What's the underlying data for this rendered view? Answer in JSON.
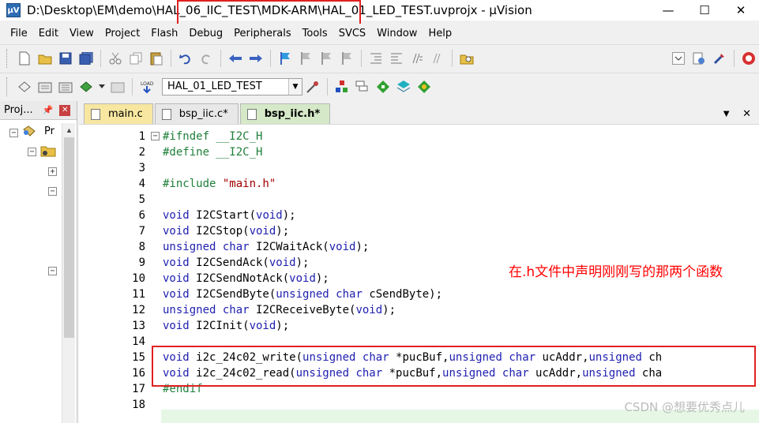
{
  "window": {
    "title": "D:\\Desktop\\EM\\demo\\HAL_06_IIC_TEST\\MDK-ARM\\HAL_01_LED_TEST.uvprojx - µVision",
    "minimize": "—",
    "maximize": "☐",
    "close": "✕"
  },
  "menu": {
    "items": [
      "File",
      "Edit",
      "View",
      "Project",
      "Flash",
      "Debug",
      "Peripherals",
      "Tools",
      "SVCS",
      "Window",
      "Help"
    ]
  },
  "toolbar2": {
    "target": "HAL_01_LED_TEST"
  },
  "project_panel": {
    "title": "Proj...",
    "pin": "ᵖ",
    "root_label": "Pr"
  },
  "editor": {
    "tabs": [
      {
        "label": "main.c"
      },
      {
        "label": "bsp_iic.c*"
      },
      {
        "label": "bsp_iic.h*"
      }
    ],
    "lines": [
      "#ifndef __I2C_H",
      "#define __I2C_H",
      "",
      "#include \"main.h\"",
      "",
      "void I2CStart(void);",
      "void I2CStop(void);",
      "unsigned char I2CWaitAck(void);",
      "void I2CSendAck(void);",
      "void I2CSendNotAck(void);",
      "void I2CSendByte(unsigned char cSendByte);",
      "unsigned char I2CReceiveByte(void);",
      "void I2CInit(void);",
      "",
      "void i2c_24c02_write(unsigned char *pucBuf,unsigned char ucAddr,unsigned ch",
      "void i2c_24c02_read(unsigned char *pucBuf,unsigned char ucAddr,unsigned cha",
      "#endif",
      ""
    ]
  },
  "annotation": "在.h文件中声明刚刚写的那两个函数",
  "watermark": "CSDN @想要优秀点儿",
  "colors": {
    "keyword": "#2020b0",
    "preprocessor": "#20803a",
    "string": "#a00000",
    "annotation": "#ff0000",
    "highlight_box": "#e02020"
  }
}
